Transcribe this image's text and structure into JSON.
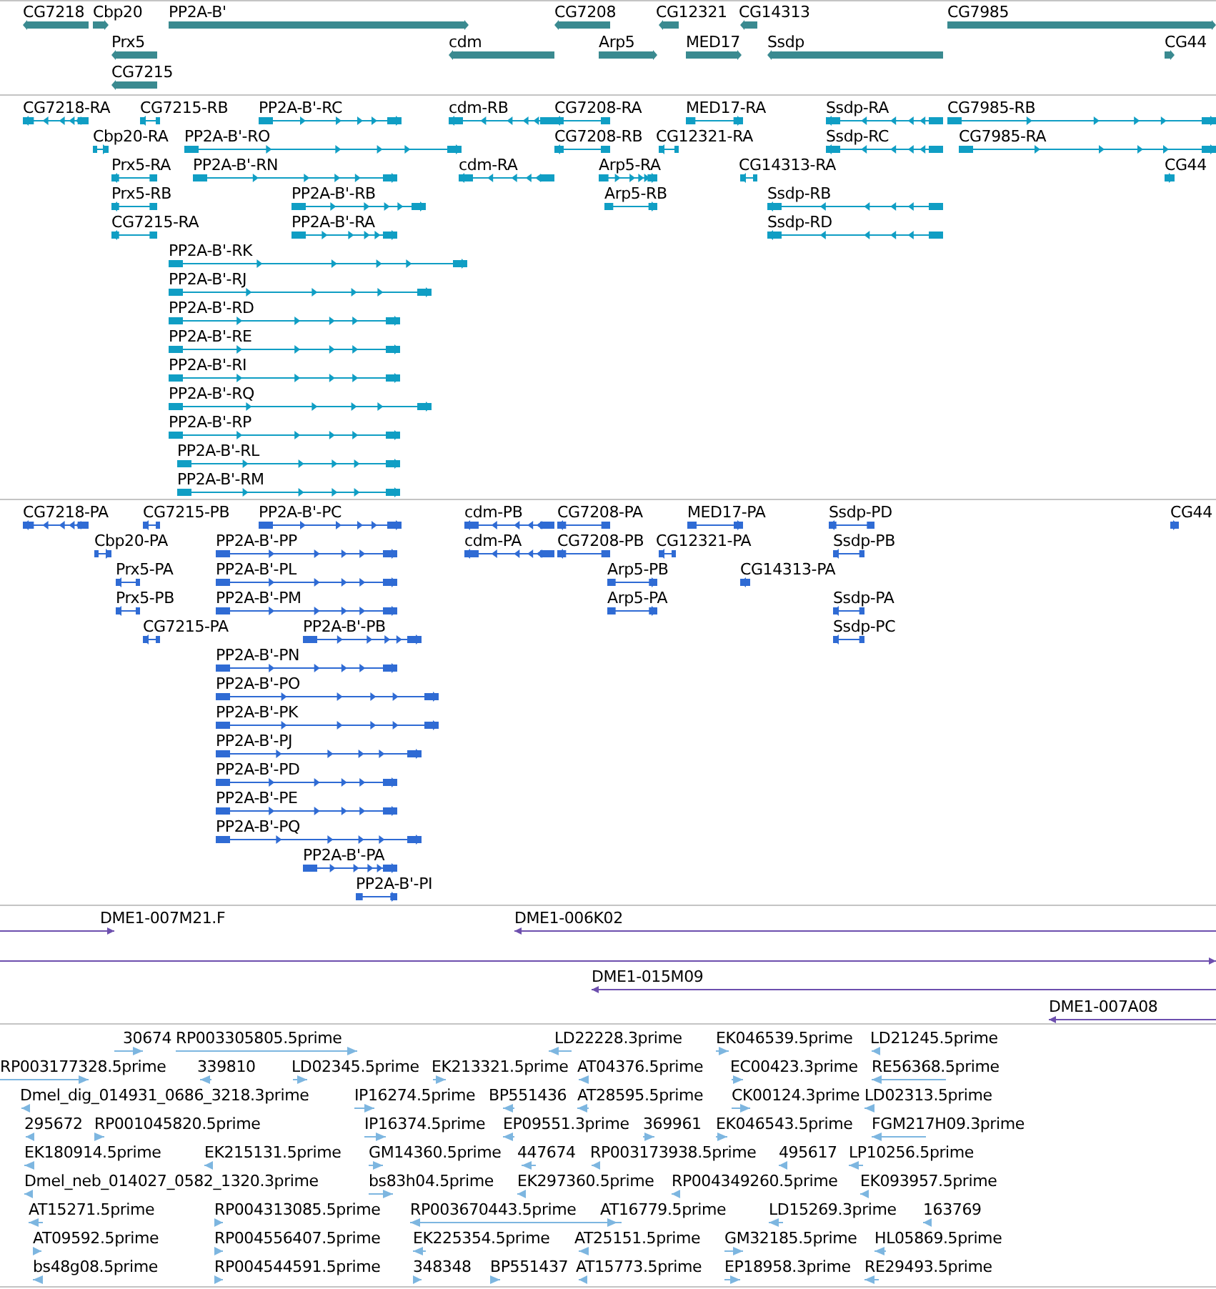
{
  "tracks": [
    {
      "color": "#3a8a90",
      "kind": "bar",
      "features": [
        {
          "label": "CG7218",
          "reverse": true
        },
        {
          "label": "Cbp20",
          "reverse": false
        },
        {
          "label": "PP2A-B'",
          "reverse": false
        },
        {
          "label": "CG7208",
          "reverse": true
        },
        {
          "label": "CG12321",
          "reverse": true
        },
        {
          "label": "CG14313",
          "reverse": true
        },
        {
          "label": "CG7985",
          "reverse": false
        },
        {
          "label": "Prx5",
          "reverse": true
        },
        {
          "label": "cdm",
          "reverse": true
        },
        {
          "label": "Arp5",
          "reverse": false
        },
        {
          "label": "MED17",
          "reverse": false
        },
        {
          "label": "Ssdp",
          "reverse": true
        },
        {
          "label": "CG44",
          "reverse": false
        },
        {
          "label": "CG7215",
          "reverse": true
        }
      ]
    },
    {
      "color": "#109ec4",
      "kind": "transcript",
      "features": [
        {
          "label": "CG7218-RA",
          "reverse": true
        },
        {
          "label": "CG7215-RB",
          "reverse": true
        },
        {
          "label": "PP2A-B'-RC",
          "reverse": false
        },
        {
          "label": "cdm-RB",
          "reverse": true
        },
        {
          "label": "CG7208-RA",
          "reverse": true
        },
        {
          "label": "MED17-RA",
          "reverse": false
        },
        {
          "label": "Ssdp-RA",
          "reverse": true
        },
        {
          "label": "CG7985-RB",
          "reverse": false
        },
        {
          "label": "Cbp20-RA",
          "reverse": false
        },
        {
          "label": "PP2A-B'-RO",
          "reverse": false
        },
        {
          "label": "CG7208-RB",
          "reverse": true
        },
        {
          "label": "CG12321-RA",
          "reverse": true
        },
        {
          "label": "Ssdp-RC",
          "reverse": true
        },
        {
          "label": "CG7985-RA",
          "reverse": false
        },
        {
          "label": "Prx5-RA",
          "reverse": true
        },
        {
          "label": "PP2A-B'-RN",
          "reverse": false
        },
        {
          "label": "cdm-RA",
          "reverse": true
        },
        {
          "label": "Arp5-RA",
          "reverse": false
        },
        {
          "label": "CG14313-RA",
          "reverse": true
        },
        {
          "label": "CG44",
          "reverse": false
        },
        {
          "label": "Prx5-RB",
          "reverse": true
        },
        {
          "label": "PP2A-B'-RB",
          "reverse": false
        },
        {
          "label": "Arp5-RB",
          "reverse": false
        },
        {
          "label": "Ssdp-RB",
          "reverse": true
        },
        {
          "label": "CG7215-RA",
          "reverse": true
        },
        {
          "label": "PP2A-B'-RA",
          "reverse": false
        },
        {
          "label": "Ssdp-RD",
          "reverse": true
        },
        {
          "label": "PP2A-B'-RK",
          "reverse": false
        },
        {
          "label": "PP2A-B'-RJ",
          "reverse": false
        },
        {
          "label": "PP2A-B'-RD",
          "reverse": false
        },
        {
          "label": "PP2A-B'-RE",
          "reverse": false
        },
        {
          "label": "PP2A-B'-RI",
          "reverse": false
        },
        {
          "label": "PP2A-B'-RQ",
          "reverse": false
        },
        {
          "label": "PP2A-B'-RP",
          "reverse": false
        },
        {
          "label": "PP2A-B'-RL",
          "reverse": false
        },
        {
          "label": "PP2A-B'-RM",
          "reverse": false
        }
      ]
    },
    {
      "color": "#2f6bd4",
      "kind": "transcript",
      "features": [
        {
          "label": "CG7218-PA",
          "reverse": true
        },
        {
          "label": "CG7215-PB",
          "reverse": true
        },
        {
          "label": "PP2A-B'-PC",
          "reverse": false
        },
        {
          "label": "cdm-PB",
          "reverse": true
        },
        {
          "label": "CG7208-PA",
          "reverse": true
        },
        {
          "label": "MED17-PA",
          "reverse": false
        },
        {
          "label": "Ssdp-PD",
          "reverse": true
        },
        {
          "label": "CG44",
          "reverse": false
        },
        {
          "label": "Cbp20-PA",
          "reverse": false
        },
        {
          "label": "PP2A-B'-PP",
          "reverse": false
        },
        {
          "label": "cdm-PA",
          "reverse": true
        },
        {
          "label": "CG7208-PB",
          "reverse": true
        },
        {
          "label": "CG12321-PA",
          "reverse": true
        },
        {
          "label": "Ssdp-PB",
          "reverse": true
        },
        {
          "label": "Prx5-PA",
          "reverse": true
        },
        {
          "label": "PP2A-B'-PL",
          "reverse": false
        },
        {
          "label": "Arp5-PB",
          "reverse": false
        },
        {
          "label": "CG14313-PA",
          "reverse": true
        },
        {
          "label": "Prx5-PB",
          "reverse": true
        },
        {
          "label": "PP2A-B'-PM",
          "reverse": false
        },
        {
          "label": "Arp5-PA",
          "reverse": false
        },
        {
          "label": "Ssdp-PA",
          "reverse": true
        },
        {
          "label": "CG7215-PA",
          "reverse": true
        },
        {
          "label": "PP2A-B'-PB",
          "reverse": false
        },
        {
          "label": "Ssdp-PC",
          "reverse": true
        },
        {
          "label": "PP2A-B'-PN",
          "reverse": false
        },
        {
          "label": "PP2A-B'-PO",
          "reverse": false
        },
        {
          "label": "PP2A-B'-PK",
          "reverse": false
        },
        {
          "label": "PP2A-B'-PJ",
          "reverse": false
        },
        {
          "label": "PP2A-B'-PD",
          "reverse": false
        },
        {
          "label": "PP2A-B'-PE",
          "reverse": false
        },
        {
          "label": "PP2A-B'-PQ",
          "reverse": false
        },
        {
          "label": "PP2A-B'-PA",
          "reverse": false
        },
        {
          "label": "PP2A-B'-PI",
          "reverse": false
        }
      ]
    },
    {
      "color": "#6d4fae",
      "kind": "line",
      "features": [
        {
          "label": "DME1-007M21.F",
          "reverse": false
        },
        {
          "label": "DME1-006K02",
          "reverse": true
        },
        {
          "reverse": false
        },
        {
          "label": "DME1-015M09",
          "reverse": true
        },
        {
          "label": "DME1-007A08",
          "reverse": true
        }
      ]
    },
    {
      "color": "#7db6e0",
      "kind": "est",
      "features": [
        {
          "label": "30674",
          "reverse": false
        },
        {
          "label": "RP003305805.5prime",
          "reverse": false
        },
        {
          "label": "LD22228.3prime",
          "reverse": true
        },
        {
          "label": "EK046539.5prime",
          "reverse": false
        },
        {
          "label": "LD21245.5prime",
          "reverse": true
        },
        {
          "label": "RP003177328.5prime",
          "reverse": false
        },
        {
          "label": "339810",
          "reverse": true
        },
        {
          "label": "LD02345.5prime",
          "reverse": false
        },
        {
          "label": "EK213321.5prime",
          "reverse": false
        },
        {
          "label": "AT04376.5prime",
          "reverse": true
        },
        {
          "label": "EC00423.3prime",
          "reverse": false
        },
        {
          "label": "RE56368.5prime",
          "reverse": true
        },
        {
          "label": "Dmel_dig_014931_0686_3218.3prime",
          "reverse": true
        },
        {
          "label": "IP16274.5prime",
          "reverse": false
        },
        {
          "label": "BP551436",
          "reverse": true
        },
        {
          "label": "AT28595.5prime",
          "reverse": true
        },
        {
          "label": "CK00124.3prime",
          "reverse": false
        },
        {
          "label": "LD02313.5prime",
          "reverse": true
        },
        {
          "label": "295672",
          "reverse": true
        },
        {
          "label": "RP001045820.5prime",
          "reverse": false
        },
        {
          "label": "IP16374.5prime",
          "reverse": false
        },
        {
          "label": "EP09551.3prime",
          "reverse": true
        },
        {
          "label": "369961",
          "reverse": false
        },
        {
          "label": "EK046543.5prime",
          "reverse": false
        },
        {
          "label": "FGM217H09.3prime",
          "reverse": true
        },
        {
          "label": "EK180914.5prime",
          "reverse": true
        },
        {
          "label": "EK215131.5prime",
          "reverse": true
        },
        {
          "label": "GM14360.5prime",
          "reverse": false
        },
        {
          "label": "447674",
          "reverse": true
        },
        {
          "label": "RP003173938.5prime",
          "reverse": true
        },
        {
          "label": "495617",
          "reverse": true
        },
        {
          "label": "LP10256.5prime",
          "reverse": true
        },
        {
          "label": "Dmel_neb_014027_0582_1320.3prime",
          "reverse": true
        },
        {
          "label": "bs83h04.5prime",
          "reverse": false
        },
        {
          "label": "EK297360.5prime",
          "reverse": true
        },
        {
          "label": "RP004349260.5prime",
          "reverse": true
        },
        {
          "label": "EK093957.5prime",
          "reverse": true
        },
        {
          "label": "AT15271.5prime",
          "reverse": true
        },
        {
          "label": "RP004313085.5prime",
          "reverse": false
        },
        {
          "label": "RP003670443.5prime",
          "reverse": true
        },
        {
          "label": "AT16779.5prime",
          "reverse": false
        },
        {
          "label": "LD15269.3prime",
          "reverse": true
        },
        {
          "label": "163769",
          "reverse": true
        },
        {
          "label": "AT09592.5prime",
          "reverse": false
        },
        {
          "label": "RP004556407.5prime",
          "reverse": false
        },
        {
          "label": "EK225354.5prime",
          "reverse": true
        },
        {
          "label": "AT25151.5prime",
          "reverse": true
        },
        {
          "label": "GM32185.5prime",
          "reverse": false
        },
        {
          "label": "HL05869.5prime",
          "reverse": true
        },
        {
          "label": "bs48g08.5prime",
          "reverse": true
        },
        {
          "label": "RP004544591.5prime",
          "reverse": false
        },
        {
          "label": "348348",
          "reverse": false
        },
        {
          "label": "BP551437",
          "reverse": false
        },
        {
          "label": "AT15773.5prime",
          "reverse": true
        },
        {
          "label": "EP18958.3prime",
          "reverse": false
        },
        {
          "label": "RE29493.5prime",
          "reverse": true
        }
      ]
    }
  ]
}
